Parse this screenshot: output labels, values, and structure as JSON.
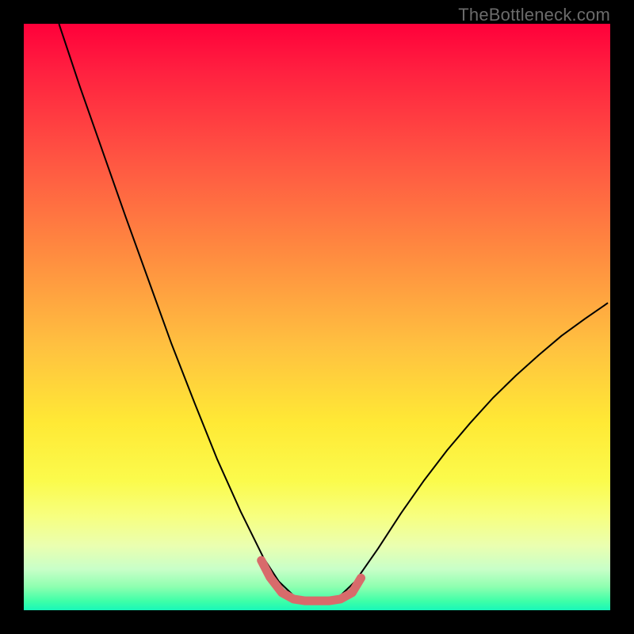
{
  "watermark": "TheBottleneck.com",
  "chart_data": {
    "type": "line",
    "title": "",
    "xlabel": "",
    "ylabel": "",
    "xlim": [
      0,
      1
    ],
    "ylim": [
      0,
      1
    ],
    "legend": false,
    "grid": false,
    "background": "rainbow-gradient-vertical",
    "series": [
      {
        "name": "bottleneck-curve",
        "color": "#000000",
        "stroke_width": 2,
        "x": [
          0.06,
          0.096,
          0.135,
          0.174,
          0.213,
          0.252,
          0.291,
          0.33,
          0.37,
          0.409,
          0.435,
          0.461,
          0.5,
          0.539,
          0.565,
          0.604,
          0.643,
          0.683,
          0.722,
          0.761,
          0.8,
          0.839,
          0.878,
          0.917,
          0.957,
          0.996
        ],
        "values": [
          1.0,
          0.892,
          0.781,
          0.67,
          0.562,
          0.454,
          0.354,
          0.257,
          0.168,
          0.089,
          0.049,
          0.024,
          0.016,
          0.024,
          0.049,
          0.105,
          0.165,
          0.222,
          0.273,
          0.319,
          0.362,
          0.4,
          0.435,
          0.468,
          0.497,
          0.524
        ]
      },
      {
        "name": "highlight-band",
        "color": "#d86b6b",
        "stroke_width": 11,
        "linecap": "round",
        "x": [
          0.405,
          0.42,
          0.44,
          0.46,
          0.48,
          0.5,
          0.52,
          0.54,
          0.56,
          0.575
        ],
        "values": [
          0.085,
          0.056,
          0.03,
          0.019,
          0.016,
          0.016,
          0.016,
          0.019,
          0.03,
          0.055
        ]
      }
    ]
  }
}
